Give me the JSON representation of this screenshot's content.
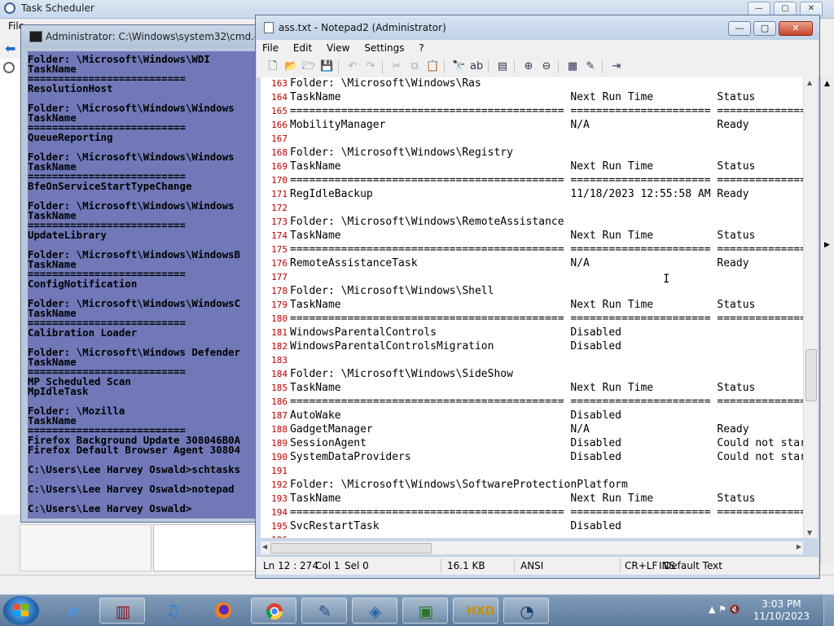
{
  "task_scheduler": {
    "title": "Task Scheduler",
    "menu_partial": "File"
  },
  "cmd": {
    "title": "Administrator: C:\\Windows\\system32\\cmd.exe",
    "lines": [
      "Folder: \\Microsoft\\Windows\\WDI",
      "TaskName",
      "==========================",
      "ResolutionHost",
      "",
      "Folder: \\Microsoft\\Windows\\Windows",
      "TaskName",
      "==========================",
      "QueueReporting",
      "",
      "Folder: \\Microsoft\\Windows\\Windows",
      "TaskName",
      "==========================",
      "BfeOnServiceStartTypeChange",
      "",
      "Folder: \\Microsoft\\Windows\\Windows",
      "TaskName",
      "==========================",
      "UpdateLibrary",
      "",
      "Folder: \\Microsoft\\Windows\\WindowsB",
      "TaskName",
      "==========================",
      "ConfigNotification",
      "",
      "Folder: \\Microsoft\\Windows\\WindowsC",
      "TaskName",
      "==========================",
      "Calibration Loader",
      "",
      "Folder: \\Microsoft\\Windows Defender",
      "TaskName",
      "==========================",
      "MP Scheduled Scan",
      "MpIdleTask",
      "",
      "Folder: \\Mozilla",
      "TaskName",
      "==========================",
      "Firefox Background Update 308046B0A",
      "Firefox Default Browser Agent 30804",
      "",
      "C:\\Users\\Lee Harvey Oswald>schtasks",
      "",
      "C:\\Users\\Lee Harvey Oswald>notepad",
      "",
      "C:\\Users\\Lee Harvey Oswald>"
    ]
  },
  "notepad": {
    "title": "ass.txt - Notepad2 (Administrator)",
    "window_buttons": {
      "minimize": "—",
      "maximize": "▢",
      "close": "✕"
    },
    "menu": [
      "File",
      "Edit",
      "View",
      "Settings",
      "?"
    ],
    "lines": [
      {
        "n": "163",
        "t": "Folder: \\Microsoft\\Windows\\Ras"
      },
      {
        "n": "164",
        "t": "TaskName                                    Next Run Time          Status"
      },
      {
        "n": "165",
        "t": "=========================================== ====================== ==============="
      },
      {
        "n": "166",
        "t": "MobilityManager                             N/A                    Ready"
      },
      {
        "n": "167",
        "t": ""
      },
      {
        "n": "168",
        "t": "Folder: \\Microsoft\\Windows\\Registry"
      },
      {
        "n": "169",
        "t": "TaskName                                    Next Run Time          Status"
      },
      {
        "n": "170",
        "t": "=========================================== ====================== ==============="
      },
      {
        "n": "171",
        "t": "RegIdleBackup                               11/18/2023 12:55:58 AM Ready"
      },
      {
        "n": "172",
        "t": ""
      },
      {
        "n": "173",
        "t": "Folder: \\Microsoft\\Windows\\RemoteAssistance"
      },
      {
        "n": "174",
        "t": "TaskName                                    Next Run Time          Status"
      },
      {
        "n": "175",
        "t": "=========================================== ====================== ==============="
      },
      {
        "n": "176",
        "t": "RemoteAssistanceTask                        N/A                    Ready"
      },
      {
        "n": "177",
        "t": ""
      },
      {
        "n": "178",
        "t": "Folder: \\Microsoft\\Windows\\Shell"
      },
      {
        "n": "179",
        "t": "TaskName                                    Next Run Time          Status"
      },
      {
        "n": "180",
        "t": "=========================================== ====================== ==============="
      },
      {
        "n": "181",
        "t": "WindowsParentalControls                     Disabled"
      },
      {
        "n": "182",
        "t": "WindowsParentalControlsMigration            Disabled"
      },
      {
        "n": "183",
        "t": ""
      },
      {
        "n": "184",
        "t": "Folder: \\Microsoft\\Windows\\SideShow"
      },
      {
        "n": "185",
        "t": "TaskName                                    Next Run Time          Status"
      },
      {
        "n": "186",
        "t": "=========================================== ====================== ==============="
      },
      {
        "n": "187",
        "t": "AutoWake                                    Disabled"
      },
      {
        "n": "188",
        "t": "GadgetManager                               N/A                    Ready"
      },
      {
        "n": "189",
        "t": "SessionAgent                                Disabled               Could not start"
      },
      {
        "n": "190",
        "t": "SystemDataProviders                         Disabled               Could not start"
      },
      {
        "n": "191",
        "t": ""
      },
      {
        "n": "192",
        "t": "Folder: \\Microsoft\\Windows\\SoftwareProtectionPlatform"
      },
      {
        "n": "193",
        "t": "TaskName                                    Next Run Time          Status"
      },
      {
        "n": "194",
        "t": "=========================================== ====================== ==============="
      },
      {
        "n": "195",
        "t": "SvcRestartTask                              Disabled"
      },
      {
        "n": "196",
        "t": ""
      }
    ],
    "status": {
      "position": "Ln 12 : 274",
      "col": "Col 1",
      "sel": "Sel 0",
      "size": "16.1 KB",
      "encoding": "ANSI",
      "eol": "CR+LF",
      "ins": "INS",
      "scheme": "Default Text"
    }
  },
  "taskbar": {
    "apps": [
      "windows-explorer",
      "internet-explorer",
      "winrar",
      "itunes",
      "firefox",
      "chrome",
      "notepad2",
      "virtualbox",
      "cmd",
      "hxd",
      "task-scheduler"
    ],
    "clock_time": "3:03 PM",
    "clock_date": "11/10/2023"
  }
}
